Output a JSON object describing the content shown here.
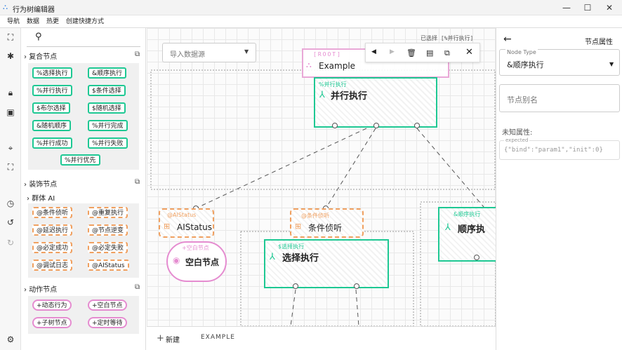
{
  "window": {
    "title": "行为树编辑器",
    "min": "—",
    "max": "☐",
    "close": "✕"
  },
  "menu": [
    "导航",
    "数据",
    "热更",
    "创建快捷方式"
  ],
  "palette": {
    "search_icon": "search-icon",
    "composite": {
      "title": "复合节点",
      "items": [
        "%选择执行",
        "&顺序执行",
        "%并行执行",
        "$条件选择",
        "$布尔选择",
        "$随机选择",
        "&随机顺序",
        "%并行完成",
        "%并行成功",
        "%并行失败",
        "%并行优先"
      ]
    },
    "decorator": {
      "title": "装饰节点",
      "sub": "群体 AI",
      "items": [
        "@条件侦听",
        "@重复执行",
        "@延迟执行",
        "@节点逆变",
        "@必定成功",
        "@必定失败",
        "@调试日志",
        "@AIStatus"
      ]
    },
    "action": {
      "title": "动作节点",
      "items": [
        "+动态行为",
        "+空白节点",
        "+子树节点",
        "+定时等待"
      ]
    }
  },
  "canvas": {
    "import_placeholder": "导入数据源",
    "selected_text": "已选择 [%并行执行]",
    "root": {
      "tag": "[ROOT]",
      "label": "Example"
    },
    "nodes": {
      "parallel": {
        "tag": "%并行执行",
        "label": "并行执行"
      },
      "aistatus": {
        "tag": "@AIStatus",
        "label": "AIStatus"
      },
      "condlisten": {
        "tag": "@条件侦听",
        "label": "条件侦听"
      },
      "blank": {
        "tag": "+空白节点",
        "label": "空白节点"
      },
      "select": {
        "tag": "$选择执行",
        "label": "选择执行"
      },
      "sequence": {
        "tag": "&顺序执行",
        "label": "顺序执"
      }
    }
  },
  "bottom": {
    "new_label": "新建",
    "tab": "EXAMPLE"
  },
  "right": {
    "back_icon": "arrow-left-icon",
    "title": "节点属性",
    "node_type_label": "Node Type",
    "node_type_value": "&顺序执行",
    "alias_placeholder": "节点别名",
    "unknown_label": "未知属性:",
    "expected_label": "expected",
    "expected_value": "{\"bind\":\"param1\",\"init\":0}"
  },
  "colors": {
    "green": "#1ec893",
    "orange": "#f0a060",
    "pink": "#e58cd0"
  }
}
